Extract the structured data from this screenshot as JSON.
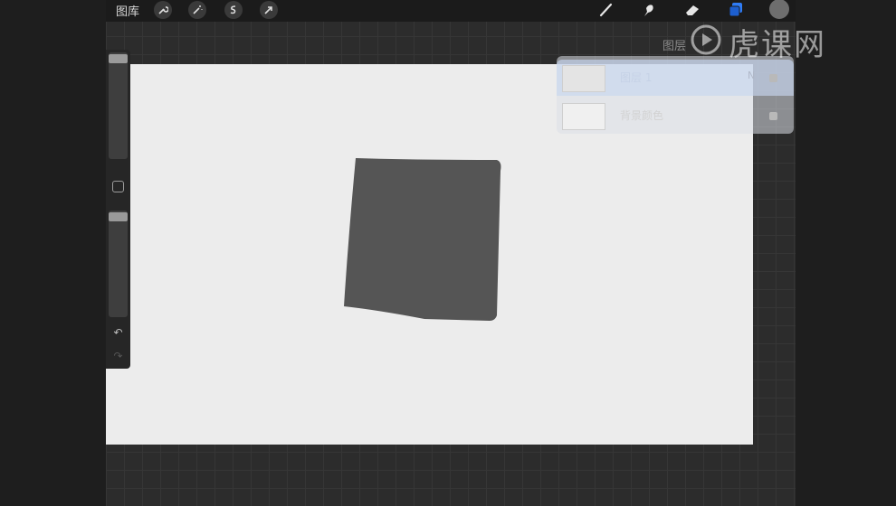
{
  "toolbar": {
    "gallery_label": "图库",
    "left_tools": [
      "wrench-icon",
      "magic-wand-icon",
      "selection-icon",
      "transform-arrow-icon"
    ],
    "right_tools": [
      "brush-icon",
      "smudge-icon",
      "eraser-icon",
      "layers-icon",
      "color-swatch"
    ],
    "accent_color": "#2f7cf6",
    "color_swatch": "#6e6e6e"
  },
  "canvas": {
    "background": "#ececec",
    "shape_fill": "#555555"
  },
  "sidebar": {
    "brush_size_level": 0.0,
    "opacity_level": 0.0
  },
  "layers_panel": {
    "title": "图层",
    "layers": [
      {
        "name": "图层 1",
        "number": "N",
        "visible": true,
        "active": true
      },
      {
        "name": "背景颜色",
        "number": "",
        "visible": true,
        "active": false
      }
    ]
  },
  "watermark": {
    "text": "虎课网"
  }
}
